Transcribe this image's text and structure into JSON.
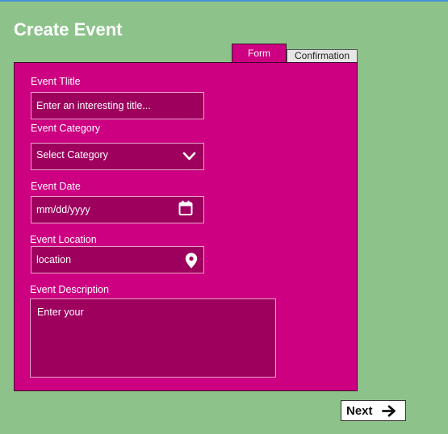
{
  "page": {
    "title": "Create Event"
  },
  "tabs": [
    {
      "label": "Form",
      "active": true
    },
    {
      "label": "Confirmation",
      "active": false
    }
  ],
  "form": {
    "title_label": "Event Tlitle",
    "title_placeholder": "Enter an interesting title...",
    "category_label": "Event Category",
    "category_value": "Select Category",
    "date_label": "Event Date",
    "date_placeholder": "mm/dd/yyyy",
    "location_label": "Event Location",
    "location_placeholder": "location",
    "description_label": "Event Description",
    "description_placeholder": "Enter your"
  },
  "footer": {
    "next_label": "Next"
  },
  "icons": {
    "category": "chevron-down-icon",
    "date": "calendar-icon",
    "location": "map-pin-icon",
    "next": "arrow-right-icon"
  },
  "colors": {
    "background": "#8dc38b",
    "panel": "#cc0080",
    "field": "#9e005e",
    "field_border": "#e7a3cb"
  }
}
